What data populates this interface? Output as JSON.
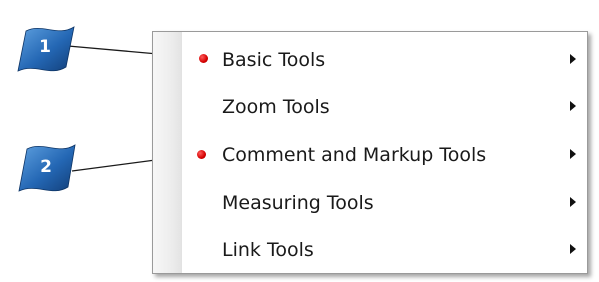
{
  "menu": {
    "items": [
      {
        "label": "Basic Tools"
      },
      {
        "label": "Zoom Tools"
      },
      {
        "label": "Comment and Markup Tools"
      },
      {
        "label": "Measuring Tools"
      },
      {
        "label": "Link Tools"
      }
    ]
  },
  "callouts": [
    {
      "number": "1",
      "target": "Basic Tools"
    },
    {
      "number": "2",
      "target": "Comment and Markup Tools"
    }
  ],
  "colors": {
    "callout_blue": "#1f5fa8",
    "bullet_red": "#d40000"
  }
}
